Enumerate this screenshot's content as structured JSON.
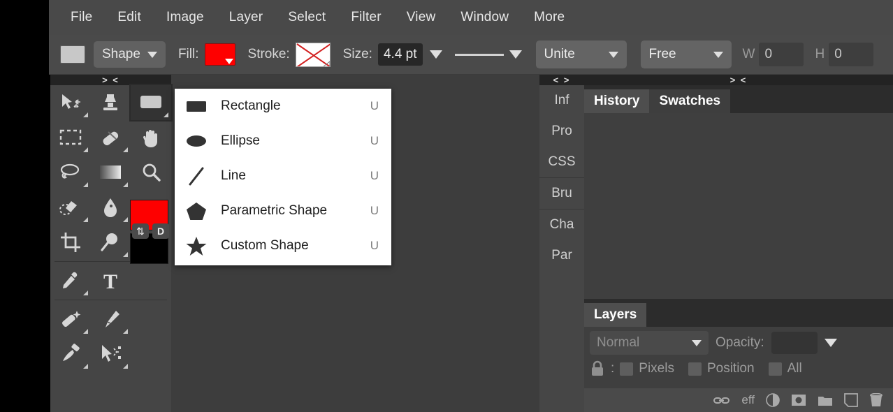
{
  "menubar": {
    "items": [
      {
        "label": "File"
      },
      {
        "label": "Edit"
      },
      {
        "label": "Image"
      },
      {
        "label": "Layer"
      },
      {
        "label": "Select"
      },
      {
        "label": "Filter"
      },
      {
        "label": "View"
      },
      {
        "label": "Window"
      },
      {
        "label": "More"
      }
    ]
  },
  "options": {
    "mode_label": "Shape",
    "fill_label": "Fill:",
    "fill_color": "#fe0000",
    "stroke_label": "Stroke:",
    "stroke_value": "none",
    "size_label": "Size:",
    "size_value": "4.4 pt",
    "boolean_op": "Unite",
    "constraint": "Free",
    "w_label": "W",
    "w_value": "0",
    "h_label": "H",
    "h_value": "0"
  },
  "handles": {
    "left": "> <",
    "mid": "< >",
    "right": "> <"
  },
  "tools": {
    "items": [
      {
        "name": "move-tool",
        "selected": false
      },
      {
        "name": "clone-stamp-tool",
        "selected": false
      },
      {
        "name": "shape-tool",
        "selected": true
      },
      {
        "name": "rectangular-marquee-tool",
        "selected": false
      },
      {
        "name": "eraser-tool",
        "selected": false
      },
      {
        "name": "hand-tool",
        "selected": false
      },
      {
        "name": "lasso-tool",
        "selected": false
      },
      {
        "name": "gradient-tool",
        "selected": false
      },
      {
        "name": "zoom-tool",
        "selected": false
      },
      {
        "name": "smudge-brush-tool",
        "selected": false
      },
      {
        "name": "blur-tool",
        "selected": false
      },
      {
        "name": "crop-tool",
        "selected": false
      },
      {
        "name": "dodge-tool",
        "selected": false
      },
      {
        "name": "eyedropper-tool",
        "selected": false
      },
      {
        "name": "type-tool",
        "selected": false
      },
      {
        "name": "magic-wand-tool",
        "selected": false
      },
      {
        "name": "pen-tool",
        "selected": false
      },
      {
        "name": "brush-tool",
        "selected": false
      },
      {
        "name": "path-select-tool",
        "selected": false
      }
    ],
    "foreground_color": "#fe0000",
    "background_color": "#000000",
    "swap_label": "⇅",
    "default_label": "D"
  },
  "shape_menu": {
    "items": [
      {
        "label": "Rectangle",
        "shortcut": "U",
        "icon": "rectangle-icon"
      },
      {
        "label": "Ellipse",
        "shortcut": "U",
        "icon": "ellipse-icon"
      },
      {
        "label": "Line",
        "shortcut": "U",
        "icon": "line-icon"
      },
      {
        "label": "Parametric Shape",
        "shortcut": "U",
        "icon": "pentagon-icon"
      },
      {
        "label": "Custom Shape",
        "shortcut": "U",
        "icon": "star-icon"
      }
    ]
  },
  "vertical_tabs": {
    "items": [
      {
        "label": "Inf"
      },
      {
        "label": "Pro"
      },
      {
        "label": "CSS"
      },
      {
        "label": "Bru"
      },
      {
        "label": "Cha"
      },
      {
        "label": "Par"
      }
    ]
  },
  "top_panel": {
    "tabs": [
      {
        "label": "History",
        "active": true
      },
      {
        "label": "Swatches",
        "active": false
      }
    ]
  },
  "layers_panel": {
    "tab_label": "Layers",
    "blend_mode": "Normal",
    "opacity_label": "Opacity:",
    "opacity_value": "",
    "lock_label": ":",
    "lock_options": [
      {
        "label": "Pixels"
      },
      {
        "label": "Position"
      },
      {
        "label": "All"
      }
    ],
    "footer_icons": [
      {
        "name": "link-layers-icon",
        "glyph": "⚭"
      },
      {
        "name": "layer-effects-icon",
        "glyph": "eff"
      },
      {
        "name": "adjustment-layer-icon",
        "glyph": "◐"
      },
      {
        "name": "layer-mask-icon",
        "glyph": "▣"
      },
      {
        "name": "new-group-icon",
        "glyph": "▰"
      },
      {
        "name": "new-layer-icon",
        "glyph": "◱"
      },
      {
        "name": "delete-layer-icon",
        "glyph": "Ὕ1"
      }
    ]
  }
}
